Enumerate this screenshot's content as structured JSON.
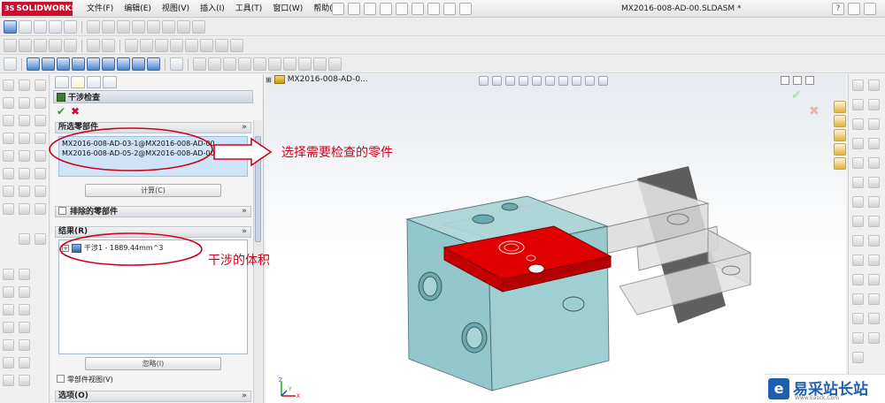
{
  "app": {
    "brand": "SOLIDWORKS",
    "brand_prefix": "3S",
    "document_title": "MX2016-008-AD-00.SLDASM *",
    "menus": [
      "文件(F)",
      "编辑(E)",
      "视图(V)",
      "插入(I)",
      "工具(T)",
      "窗口(W)",
      "帮助(H)"
    ],
    "help_glyph": "?",
    "colors": {
      "brand": "#c8102e",
      "annotation": "#d0021b",
      "selection_box": "#cfe3f6",
      "interference": "#e00000",
      "part_translucent": "#7fbfc4"
    }
  },
  "property_manager": {
    "title": "干涉检查",
    "ok_glyph": "✔",
    "cancel_glyph": "✖",
    "selected_components": {
      "header": "所选零部件",
      "items": [
        "MX2016-008-AD-03-1@MX2016-008-AD-00",
        "MX2016-008-AD-05-2@MX2016-008-AD-00"
      ],
      "calc_button": "计算(C)"
    },
    "excluded_components": {
      "header": "排除的零部件"
    },
    "results": {
      "header": "结果(R)",
      "items": [
        {
          "label": "干涉1 - 1889.44mm^3",
          "icon": "interference-icon"
        }
      ],
      "ignore_button": "忽略(I)"
    },
    "component_view_label": "零部件视图(V)",
    "options_header": "选项(O)",
    "collapse_glyph": "»"
  },
  "viewport": {
    "tree_node": "MX2016-008-AD-0...",
    "ok_glyph": "✔",
    "cancel_glyph": "✖",
    "triad": {
      "x": "X",
      "y": "Y",
      "z": "Z"
    }
  },
  "annotations": {
    "select_parts": "选择需要检查的零件",
    "interference_volume": "干涉的体积"
  },
  "watermark": {
    "logo_glyph": "e",
    "name": "易采站长站",
    "url": "Www.Easck.Com"
  }
}
